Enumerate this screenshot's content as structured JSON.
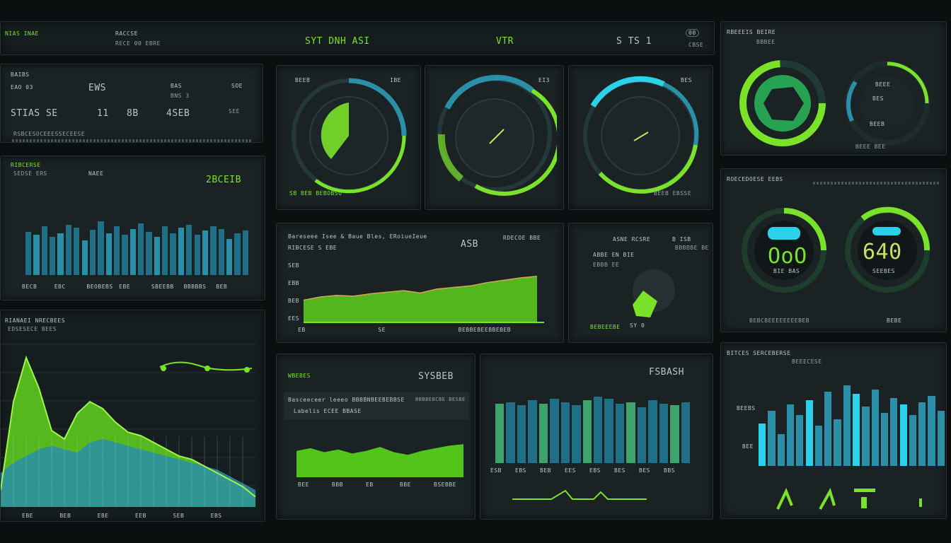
{
  "header": {
    "app_title": "NIAS INAE",
    "app_title_accent": "RACCSE",
    "app_sub": "RECE 00 EBRE",
    "center_left": "SYT  DNH  ASI",
    "center_mid": "VTR",
    "center_right": "S  TS  1",
    "right_badge": "00",
    "right_sub": "CBSE"
  },
  "stats": {
    "labels": [
      "BAIBS",
      "EWS",
      "BAS",
      "SOE"
    ],
    "sub_labels": [
      "EAO 03",
      "BNS 3"
    ],
    "values": [
      "STIAS SE",
      "11",
      "8B",
      "4SEB",
      "SEE"
    ],
    "footer": "RSBCESOCEEESSECEESE"
  },
  "bar_panel": {
    "title": "RIBCERSE",
    "subtitle": "SEDSE ERS",
    "mid": "NAEE",
    "value": "2BCEIB",
    "ticks": [
      "BECB",
      "EBC",
      "BEOBEBS",
      "EBE",
      "SBEEBB",
      "BBBBBS",
      "BEB"
    ],
    "chart_data": {
      "type": "bar",
      "categories": [
        "1",
        "2",
        "3",
        "4",
        "5",
        "6",
        "7",
        "8",
        "9",
        "10",
        "11",
        "12",
        "13",
        "14",
        "15",
        "16",
        "17",
        "18",
        "19",
        "20",
        "21",
        "22",
        "23",
        "24",
        "25",
        "26",
        "27",
        "28"
      ],
      "values": [
        62,
        58,
        70,
        55,
        60,
        72,
        68,
        50,
        65,
        78,
        60,
        70,
        58,
        66,
        75,
        62,
        55,
        70,
        60,
        68,
        72,
        58,
        64,
        70,
        66,
        52,
        60,
        64
      ]
    }
  },
  "area_panel": {
    "title": "RIANAEI NRECBEES",
    "subtitle": "EDSESECE BEES",
    "ticks": [
      "EBE",
      "BEB",
      "EBE",
      "EEB",
      "SEB",
      "EBS"
    ],
    "chart_data": {
      "type": "area",
      "x": [
        0,
        1,
        2,
        3,
        4,
        5,
        6,
        7,
        8,
        9,
        10,
        11,
        12,
        13,
        14,
        15,
        16,
        17,
        18,
        19,
        20
      ],
      "series": [
        {
          "values": [
            10,
            62,
            88,
            70,
            45,
            40,
            55,
            62,
            58,
            50,
            44,
            42,
            38,
            34,
            30,
            28,
            24,
            20,
            16,
            12,
            6
          ]
        },
        {
          "values": [
            20,
            26,
            30,
            34,
            36,
            34,
            32,
            38,
            40,
            38,
            36,
            34,
            32,
            30,
            28,
            26,
            24,
            22,
            18,
            14,
            10
          ]
        }
      ]
    }
  },
  "gauges": {
    "g1_label": "BEEB",
    "g1_sub": "IBE",
    "g2_label": "EI3",
    "g3_sub": "BES",
    "g3_foot": "BEEB EBSSE",
    "g_foot": "SB  BEB  BEBOBSO",
    "levels": [
      0.6,
      0.72,
      0.8
    ]
  },
  "line_panel": {
    "title": "Bareseee Isee & Baue  Bles, ERoiueIeue",
    "subtitle": "RIBCESE S  EBE",
    "right_value": "ASB",
    "right_label": "RDECOE BBE",
    "y_labels": [
      "SEB",
      "EBB",
      "BEB",
      "EES"
    ],
    "x_labels": [
      "EB",
      "SE",
      "BEBBEBEEBBEBEB"
    ],
    "chart_data": {
      "type": "area",
      "x": [
        0,
        1,
        2,
        3,
        4,
        5,
        6,
        7,
        8,
        9,
        10,
        11,
        12,
        13,
        14
      ],
      "values": [
        28,
        32,
        34,
        33,
        36,
        38,
        40,
        37,
        42,
        44,
        46,
        50,
        53,
        56,
        58
      ]
    }
  },
  "mid_right": {
    "title": "ASNE RCSRE",
    "value": "B ISB",
    "sub": "BBBBBE BE",
    "row": "ABBE  EN BIE",
    "footer_label": "BEBEEEBE",
    "footer_value": "SY 0",
    "foot_sub": "EBBB EE"
  },
  "bottom_mid": {
    "title": "WBEBES",
    "value": "SYSBEB",
    "label_a": "Basceeceer leeeo BBBBNBEEBEBBSE",
    "label_b": "Labelis  ECEE BBASE",
    "right_label": "BBBBEBCBE BESBE",
    "ticks": [
      "BEE",
      "BBB",
      "EB",
      "BBE",
      "BSEBBE"
    ],
    "chart_data": {
      "type": "area",
      "x": [
        0,
        1,
        2,
        3,
        4,
        5,
        6,
        7,
        8,
        9,
        10,
        11,
        12
      ],
      "values": [
        40,
        44,
        38,
        42,
        36,
        40,
        46,
        38,
        34,
        40,
        44,
        48,
        50
      ]
    }
  },
  "bottom_bars": {
    "value": "FSBASH",
    "ticks": [
      "ESB",
      "EBS",
      "BEB",
      "EES",
      "EBS",
      "BES",
      "BES",
      "BBS"
    ],
    "chart_data": {
      "type": "bar",
      "categories": [
        "1",
        "2",
        "3",
        "4",
        "5",
        "6",
        "7",
        "8",
        "9",
        "10",
        "11",
        "12",
        "13",
        "14",
        "15",
        "16",
        "17",
        "18"
      ],
      "values": [
        70,
        72,
        68,
        74,
        70,
        76,
        72,
        68,
        74,
        78,
        76,
        70,
        72,
        66,
        74,
        70,
        68,
        72
      ]
    }
  },
  "right_top": {
    "title": "RBEEEIS BEIRE",
    "sub": "BBBEE",
    "labels": [
      "BEEE",
      "BES",
      "BEEB",
      "BEEE BEE"
    ]
  },
  "right_mid": {
    "title": "ROECEDOESE EEBS",
    "value_left": "OoO",
    "sub_left": "BIE BAS",
    "value_right": "640",
    "sub_right": "SEEBES",
    "footer": "BEBCBEEEEEEEEBEB",
    "footer_right": "BEBE"
  },
  "right_bottom": {
    "title": "BITCES SERCEBERSE",
    "sub": "BEEECESE",
    "label_a": "BEEBS",
    "label_b": "BEE",
    "chart_data": {
      "type": "bar",
      "categories": [
        "1",
        "2",
        "3",
        "4",
        "5",
        "6",
        "7",
        "8",
        "9",
        "10",
        "11",
        "12",
        "13",
        "14",
        "15",
        "16",
        "17",
        "18",
        "19",
        "20"
      ],
      "values": [
        40,
        52,
        30,
        58,
        48,
        62,
        38,
        70,
        44,
        76,
        68,
        56,
        72,
        50,
        64,
        58,
        48,
        60,
        66,
        52
      ]
    }
  },
  "colors": {
    "bg": "#0b0f10",
    "panel": "#1a2224",
    "green": "#7be22a",
    "teal": "#2b8fa8",
    "cyan": "#2ad1e8"
  }
}
